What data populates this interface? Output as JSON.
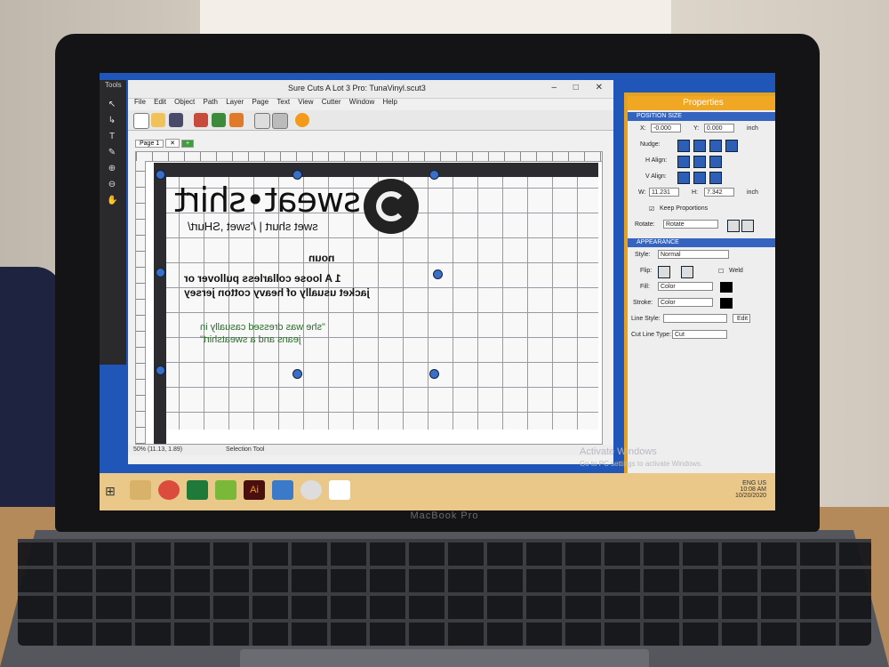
{
  "app": {
    "title": "Sure Cuts A Lot 3 Pro: TunaVinyl.scut3",
    "menu": [
      "File",
      "Edit",
      "Object",
      "Path",
      "Layer",
      "Page",
      "Text",
      "View",
      "Cutter",
      "Window",
      "Help"
    ],
    "tools_label": "Tools",
    "tab_label": "Page 1",
    "status_zoom": "50% (11.13, 1.89)",
    "status_tool": "Selection Tool"
  },
  "artwork": {
    "title": "sweat•shirt",
    "pronunciation": "swet shurt | /'swet ,SHurt/",
    "part_of_speech": "noun",
    "definition_number": "1",
    "definition": "A loose collarless pullover or jacket usually of heavy cotton jersey",
    "example": "\"she was dressed casually in jeans and a sweatshirt\""
  },
  "properties": {
    "title": "Properties",
    "position_size_header": "POSITION SIZE",
    "x_label": "X:",
    "x_value": "-0.000",
    "y_label": "Y:",
    "y_value": "0.000",
    "unit": "inch",
    "nudge_label": "Nudge:",
    "halign_label": "H Align:",
    "valign_label": "V Align:",
    "w_label": "W:",
    "w_value": "11.231",
    "h_label": "H:",
    "h_value": "7.342",
    "keep_proportions": "Keep Proportions",
    "rotate_label": "Rotate:",
    "rotate_value": "Rotate",
    "appearance_header": "APPEARANCE",
    "style_label": "Style:",
    "style_value": "Normal",
    "flip_label": "Flip:",
    "weld_label": "Weld",
    "fill_label": "Fill:",
    "fill_value": "Color",
    "stroke_label": "Stroke:",
    "stroke_value": "Color",
    "line_style_label": "Line Style:",
    "edit_button": "Edit",
    "cut_line_type_label": "Cut Line Type:",
    "cut_line_type_value": "Cut"
  },
  "desktop": {
    "watermark_title": "Activate Windows",
    "watermark_sub": "Go to PC settings to activate Windows.",
    "tray_lang": "ENG US",
    "tray_time": "10:08 AM",
    "tray_date": "10/20/2020"
  },
  "laptop": {
    "brand": "MacBook Pro"
  }
}
